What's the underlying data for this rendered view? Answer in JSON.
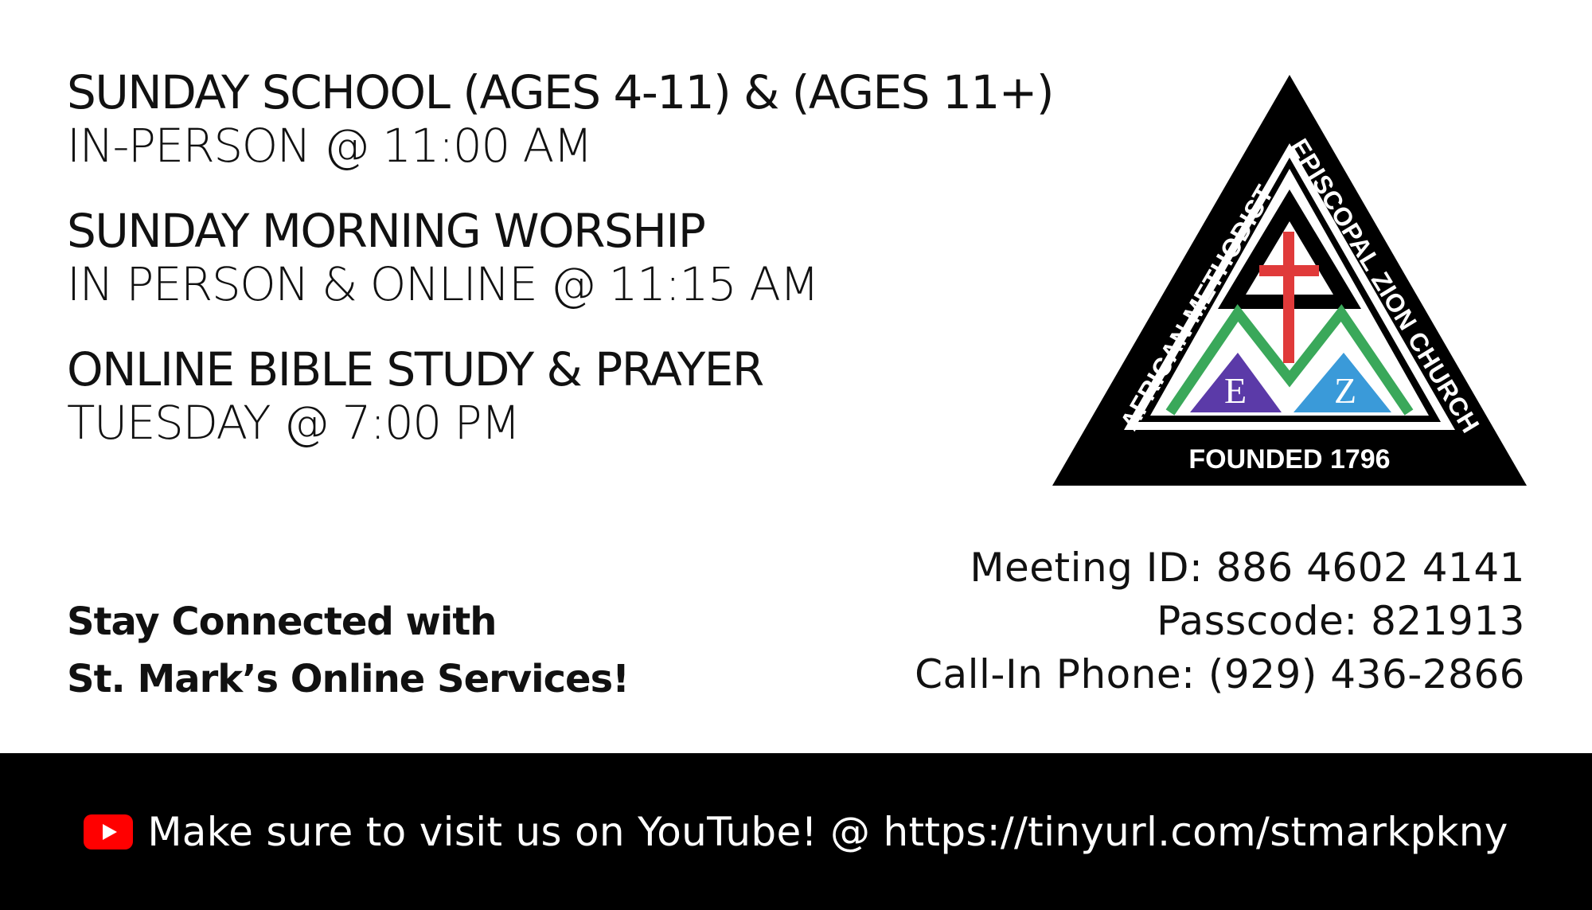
{
  "schedule": [
    {
      "title": "SUNDAY SCHOOL (AGES 4-11) & (AGES 11+)",
      "detail": "IN-PERSON @ 11:00 AM"
    },
    {
      "title": "SUNDAY MORNING WORSHIP",
      "detail": "IN PERSON & ONLINE @ 11:15 AM"
    },
    {
      "title": "ONLINE BIBLE STUDY & PRAYER",
      "detail": "TUESDAY @ 7:00 PM"
    }
  ],
  "logo": {
    "left_text": "AFRICAN METHODIST",
    "right_text": "EPISCOPAL ZION CHURCH",
    "bottom_text": "FOUNDED 1796",
    "letters": [
      "A",
      "M",
      "E",
      "Z"
    ],
    "colors": {
      "cross": "#e03a3a",
      "green": "#3aa85a",
      "purple": "#5b3aa8",
      "blue": "#3a9ad9"
    }
  },
  "connected": {
    "line1": "Stay Connected with",
    "line2": "St. Mark’s Online Services!"
  },
  "meeting": {
    "id_line": "Meeting ID:  886 4602 4141",
    "passcode_line": "Passcode: 821913",
    "phone_line": "Call-In Phone: (929) 436-2866"
  },
  "footer": {
    "text": "Make sure to visit us on YouTube! @ https://tinyurl.com/stmarkpkny",
    "icon": "youtube-icon",
    "icon_color": "#ff0000"
  }
}
